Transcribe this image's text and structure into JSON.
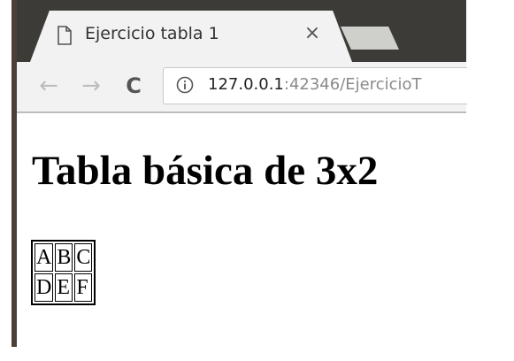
{
  "browser": {
    "tab": {
      "title": "Ejercicio tabla 1",
      "close_glyph": "×",
      "favicon": "page-icon"
    },
    "nav": {
      "back_glyph": "←",
      "forward_glyph": "→",
      "reload_glyph": "C"
    },
    "address_bar": {
      "info_icon": "info-icon",
      "url_host": "127.0.0.1",
      "url_rest": ":42346/EjercicioT"
    }
  },
  "page": {
    "heading": "Tabla básica de 3x2",
    "table": {
      "rows": [
        [
          "A",
          "B",
          "C"
        ],
        [
          "D",
          "E",
          "F"
        ]
      ]
    }
  }
}
